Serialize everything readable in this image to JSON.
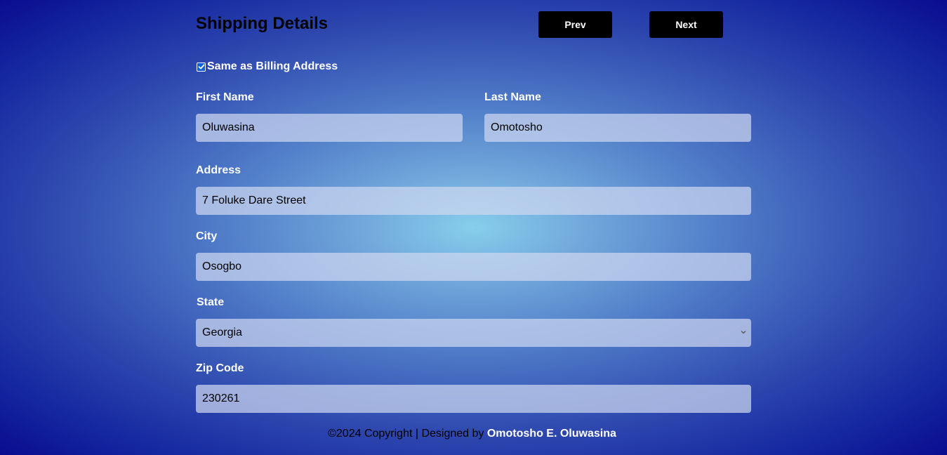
{
  "header": {
    "title": "Shipping Details",
    "prev_label": "Prev",
    "next_label": "Next"
  },
  "form": {
    "same_as_billing": {
      "label": "Same as Billing Address",
      "checked": true
    },
    "first_name": {
      "label": "First Name",
      "value": "Oluwasina"
    },
    "last_name": {
      "label": "Last Name",
      "value": "Omotosho"
    },
    "address": {
      "label": "Address",
      "value": "7 Foluke Dare Street"
    },
    "city": {
      "label": "City",
      "value": "Osogbo"
    },
    "state": {
      "label": "State",
      "value": "Georgia"
    },
    "zip": {
      "label": "Zip Code",
      "value": "230261"
    }
  },
  "footer": {
    "text": "©2024 Copyright | Designed by",
    "author": "Omotosho E. Oluwasina"
  },
  "colors": {
    "background_center": "#87ceeb",
    "background_edge": "#0a0c8f",
    "button_bg": "#000000",
    "checkbox": "#0b5fd9"
  }
}
